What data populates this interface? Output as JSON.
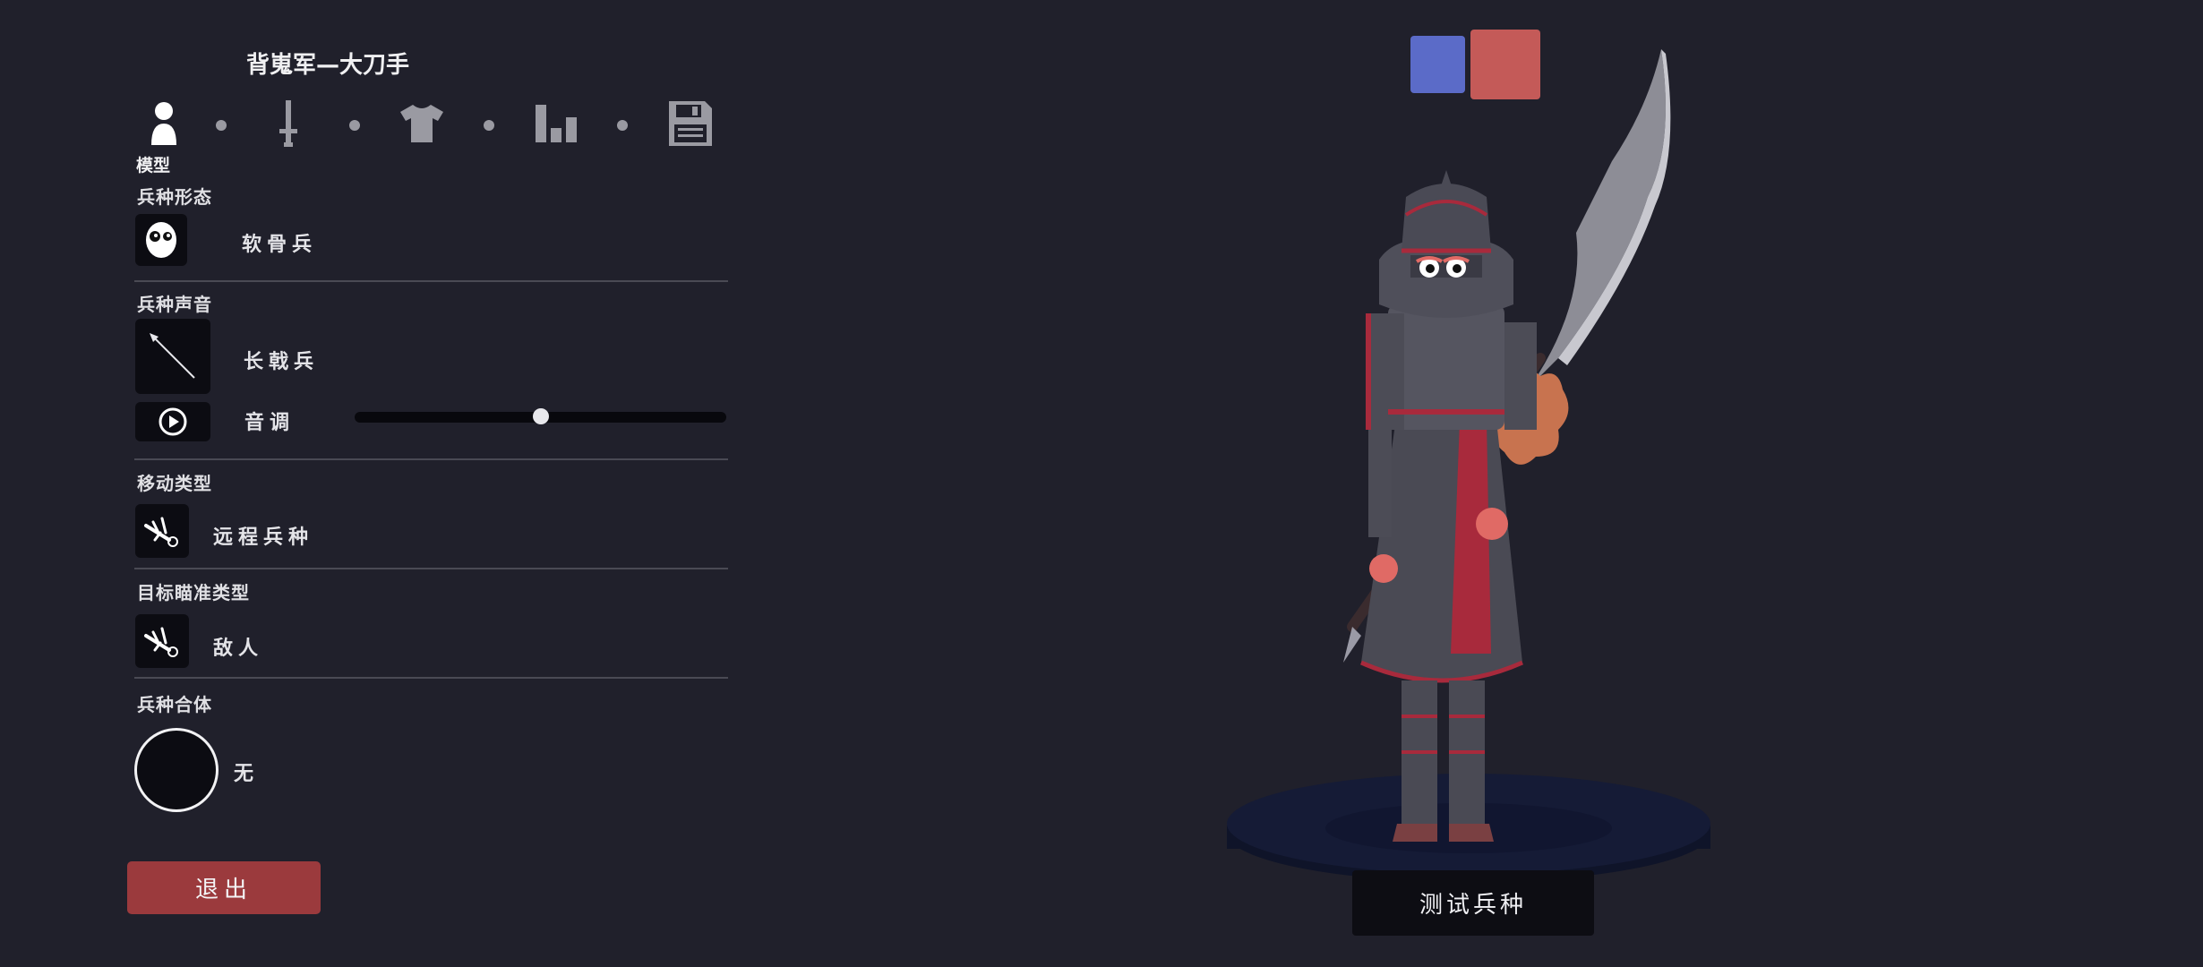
{
  "header": {
    "title": "背嵬军—大刀手"
  },
  "tabs": {
    "items": [
      {
        "icon": "person-icon",
        "label": "模型",
        "active": true
      },
      {
        "icon": "sword-icon"
      },
      {
        "icon": "shirt-icon"
      },
      {
        "icon": "stats-bars-icon"
      },
      {
        "icon": "save-disk-icon"
      }
    ]
  },
  "sections": {
    "form": {
      "label": "兵种形态",
      "value": "软骨兵",
      "icon": "face-mask-icon"
    },
    "voice": {
      "label": "兵种声音",
      "value": "长戟兵",
      "icon": "spear-icon",
      "pitch_label": "音调",
      "pitch_level": 0.5,
      "play_icon": "play-icon"
    },
    "movement": {
      "label": "移动类型",
      "value": "远程兵种",
      "icon": "fallen-unit-icon"
    },
    "targeting": {
      "label": "目标瞄准类型",
      "value": "敌人",
      "icon": "fallen-unit-icon"
    },
    "merge": {
      "label": "兵种合体",
      "value": "无"
    }
  },
  "buttons": {
    "exit": "退出",
    "test": "测试兵种"
  },
  "team_colors": {
    "blue": "#5b6bc8",
    "red": "#c45a58"
  },
  "colors": {
    "background": "#20202b",
    "exit_button": "#9b3a3d",
    "platform": "#141a33"
  }
}
